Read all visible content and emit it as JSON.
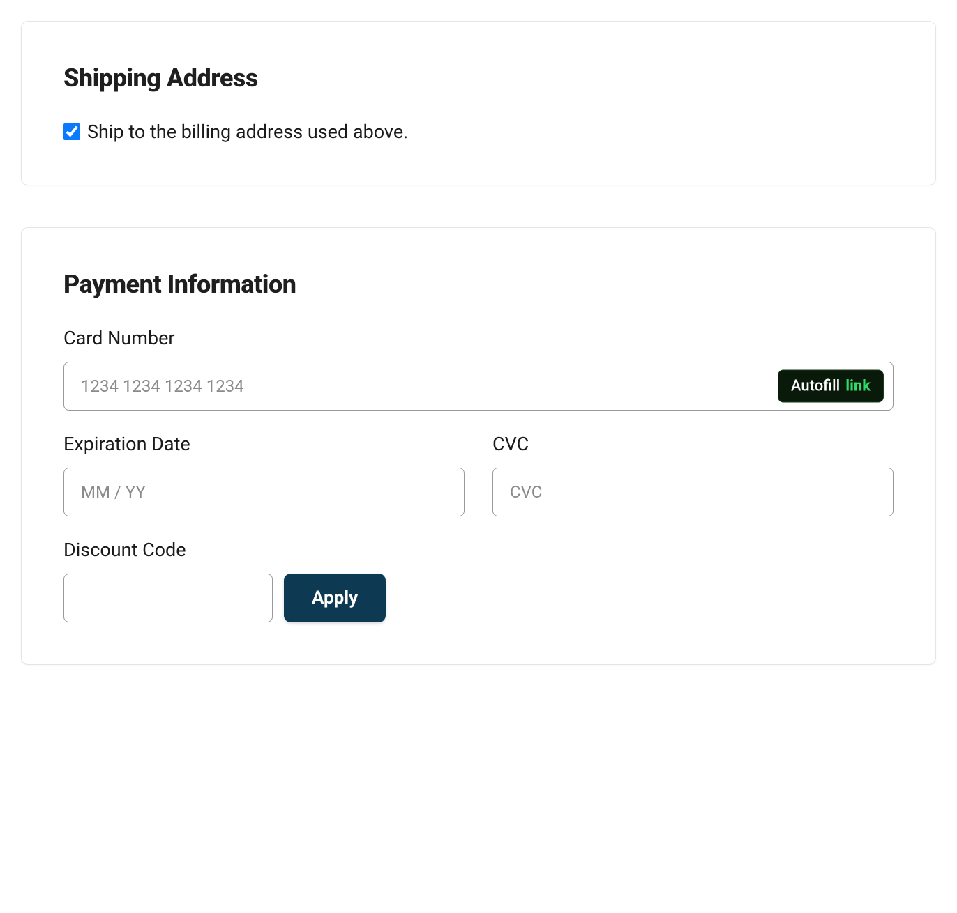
{
  "shipping": {
    "title": "Shipping Address",
    "checkbox_label": "Ship to the billing address used above.",
    "checkbox_checked": true
  },
  "payment": {
    "title": "Payment Information",
    "card_number": {
      "label": "Card Number",
      "placeholder": "1234 1234 1234 1234",
      "value": ""
    },
    "autofill": {
      "text": "Autofill",
      "link": "link"
    },
    "expiration": {
      "label": "Expiration Date",
      "placeholder": "MM / YY",
      "value": ""
    },
    "cvc": {
      "label": "CVC",
      "placeholder": "CVC",
      "value": ""
    },
    "discount": {
      "label": "Discount Code",
      "value": "",
      "apply_label": "Apply"
    }
  }
}
